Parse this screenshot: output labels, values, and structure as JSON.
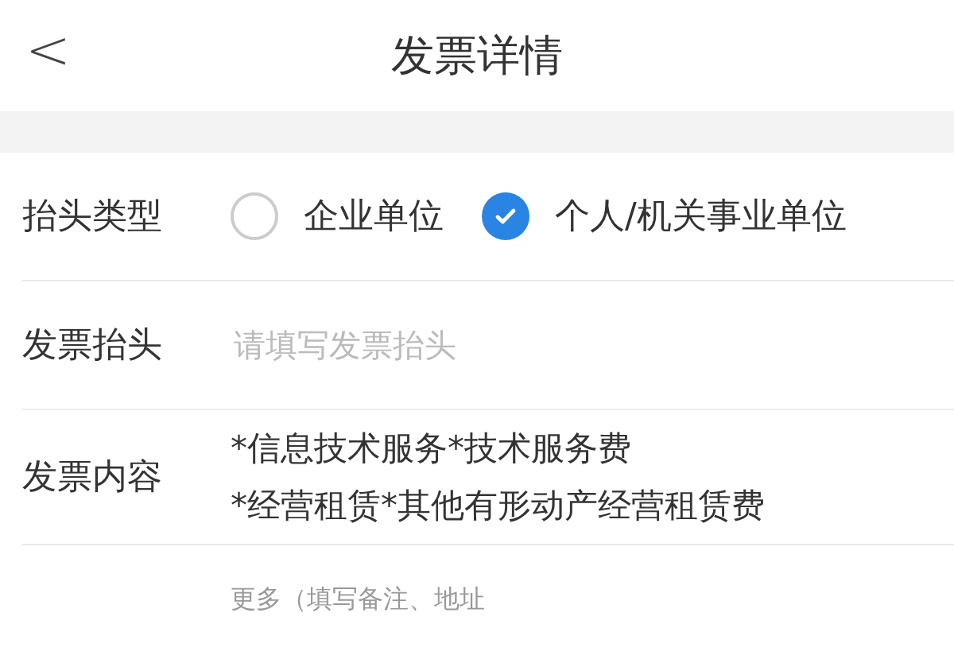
{
  "header": {
    "back": "<",
    "title": "发票详情"
  },
  "title_type": {
    "label": "抬头类型",
    "options": [
      {
        "label": "企业单位",
        "selected": false
      },
      {
        "label": "个人/机关事业单位",
        "selected": true
      }
    ]
  },
  "invoice_title": {
    "label": "发票抬头",
    "placeholder": "请填写发票抬头"
  },
  "invoice_content": {
    "label": "发票内容",
    "lines": [
      "*信息技术服务*技术服务费",
      "*经营租赁*其他有形动产经营租赁费"
    ]
  },
  "more": "更多（填写备注、地址"
}
